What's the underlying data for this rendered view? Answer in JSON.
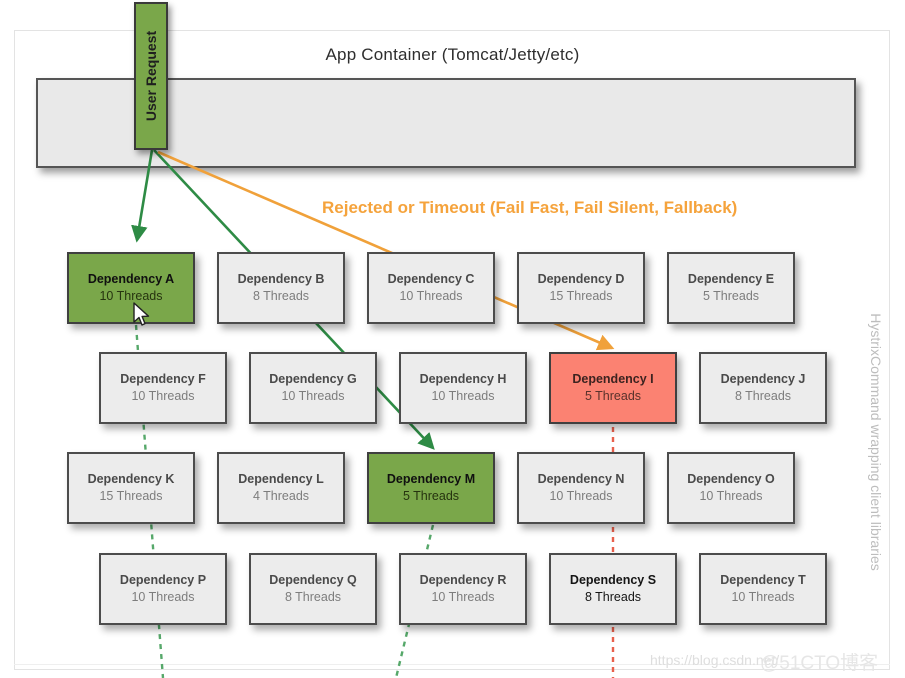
{
  "diagram": {
    "app_container_title": "App Container (Tomcat/Jetty/etc)",
    "user_request_label": "User Request",
    "reject_label": "Rejected or Timeout (Fail Fast, Fail Silent, Fallback)",
    "side_caption": "HystrixCommand wrapping client libraries",
    "watermark": "https://blog.csdn.net/",
    "watermark_cn": "@51CTO博客",
    "colors": {
      "green": "#7aa74a",
      "red": "#fb8272",
      "box_gray": "#ececec",
      "orange": "#f5a33c",
      "arrow_green": "#2e8b45",
      "arrow_red": "#e8604c",
      "border": "#4c4c4c"
    },
    "rows": [
      {
        "row": 1,
        "boxes": [
          {
            "name": "Dependency A",
            "threads": "10 Threads",
            "state": "green"
          },
          {
            "name": "Dependency B",
            "threads": "8 Threads",
            "state": "normal"
          },
          {
            "name": "Dependency C",
            "threads": "10 Threads",
            "state": "normal"
          },
          {
            "name": "Dependency D",
            "threads": "15 Threads",
            "state": "normal"
          },
          {
            "name": "Dependency E",
            "threads": "5 Threads",
            "state": "normal"
          }
        ]
      },
      {
        "row": 2,
        "boxes": [
          {
            "name": "Dependency F",
            "threads": "10 Threads",
            "state": "normal"
          },
          {
            "name": "Dependency G",
            "threads": "10 Threads",
            "state": "normal"
          },
          {
            "name": "Dependency H",
            "threads": "10 Threads",
            "state": "normal"
          },
          {
            "name": "Dependency I",
            "threads": "5 Threads",
            "state": "red"
          },
          {
            "name": "Dependency J",
            "threads": "8 Threads",
            "state": "normal"
          }
        ]
      },
      {
        "row": 3,
        "boxes": [
          {
            "name": "Dependency K",
            "threads": "15 Threads",
            "state": "normal"
          },
          {
            "name": "Dependency L",
            "threads": "4 Threads",
            "state": "normal"
          },
          {
            "name": "Dependency M",
            "threads": "5 Threads",
            "state": "green"
          },
          {
            "name": "Dependency N",
            "threads": "10 Threads",
            "state": "normal"
          },
          {
            "name": "Dependency O",
            "threads": "10 Threads",
            "state": "normal"
          }
        ]
      },
      {
        "row": 4,
        "boxes": [
          {
            "name": "Dependency P",
            "threads": "10 Threads",
            "state": "normal"
          },
          {
            "name": "Dependency Q",
            "threads": "8 Threads",
            "state": "normal"
          },
          {
            "name": "Dependency R",
            "threads": "10 Threads",
            "state": "normal"
          },
          {
            "name": "Dependency S",
            "threads": "8 Threads",
            "state": "dark"
          },
          {
            "name": "Dependency T",
            "threads": "10 Threads",
            "state": "normal"
          }
        ]
      }
    ]
  }
}
